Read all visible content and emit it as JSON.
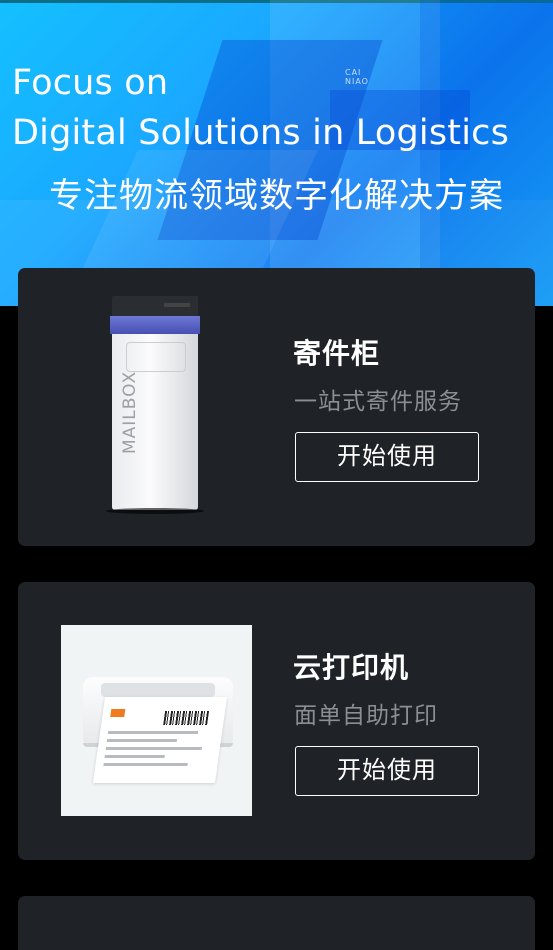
{
  "hero": {
    "title_line1": "Focus on",
    "title_line2": "Digital Solutions in Logistics",
    "subtitle": "专注物流领域数字化解决方案",
    "logo_text": "CAI\nNIAO"
  },
  "cards": [
    {
      "title": "寄件柜",
      "description": "一站式寄件服务",
      "button_label": "开始使用",
      "image_text": "MAILBOX"
    },
    {
      "title": "云打印机",
      "description": "面单自助打印",
      "button_label": "开始使用"
    }
  ],
  "colors": {
    "page_background": "#000000",
    "card_background": "#1f2226",
    "hero_blue": "#1aa8ff",
    "description_gray": "#8b8e93",
    "button_border": "#ffffff"
  }
}
